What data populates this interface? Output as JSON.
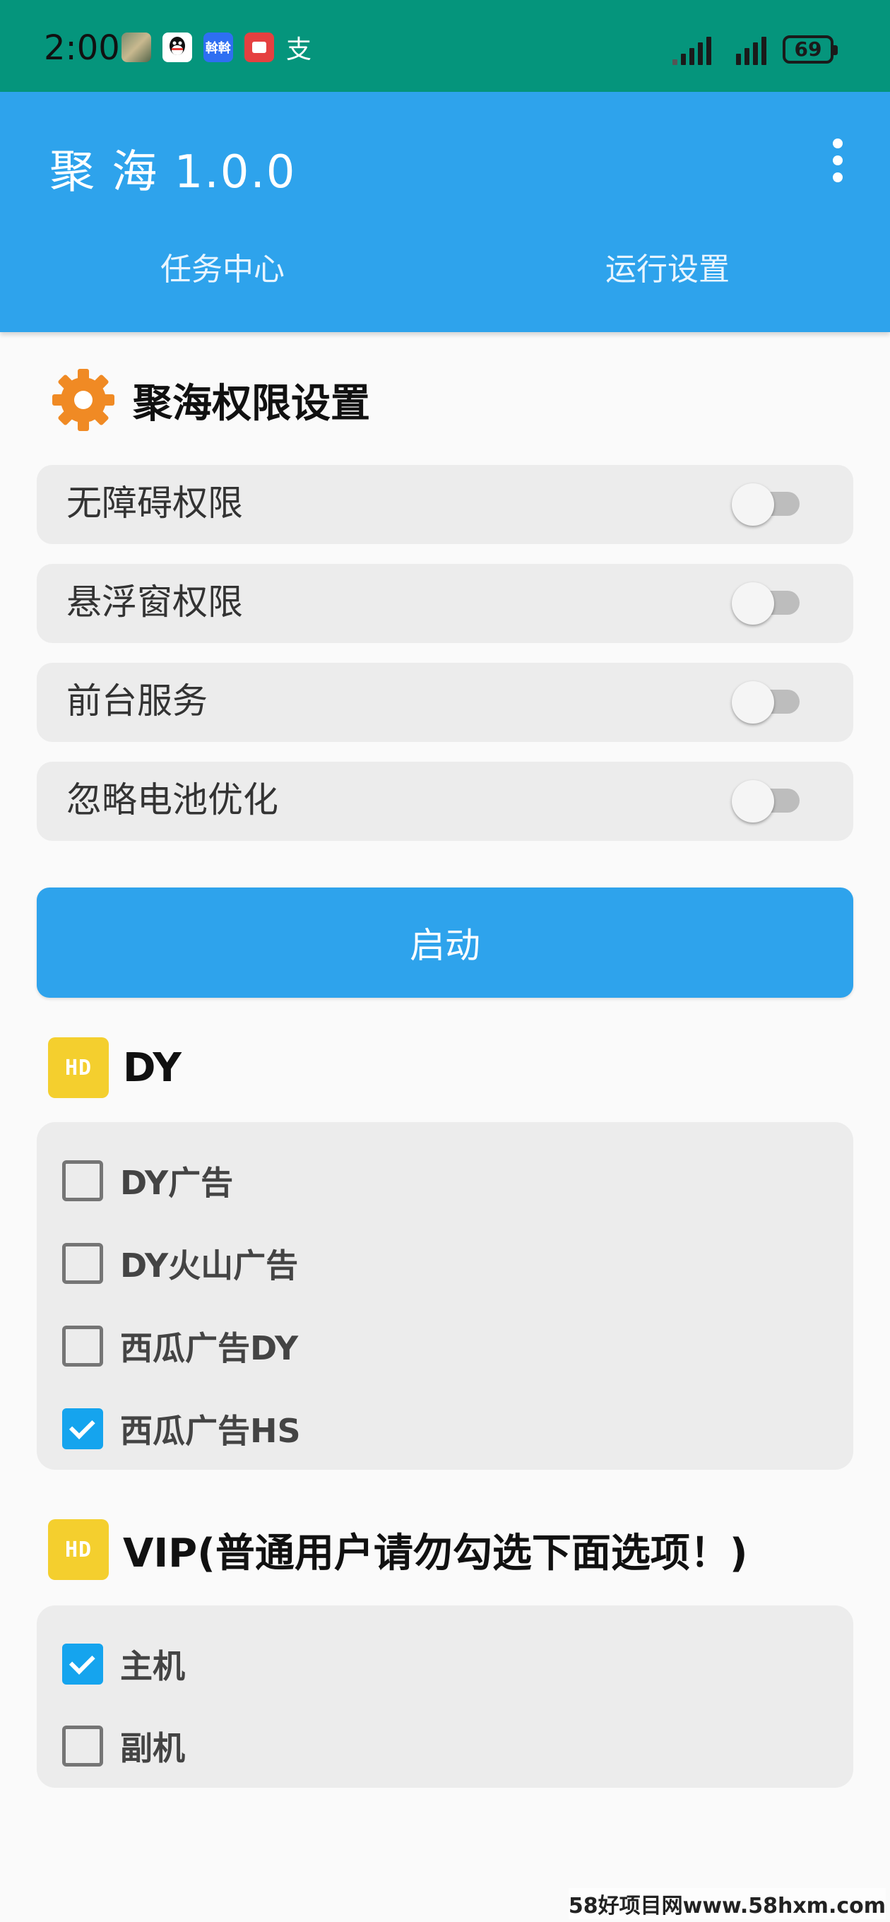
{
  "status_bar": {
    "time": "2:00",
    "battery": "69",
    "app_icons": [
      "photo-icon",
      "qq-icon",
      "app-icon",
      "video-icon",
      "alipay-icon"
    ],
    "alipay_glyph": "支",
    "blue_app_glyph": "斡斡"
  },
  "app_bar": {
    "title": "聚 海 1.0.0",
    "tabs": [
      {
        "label": "任务中心"
      },
      {
        "label": "运行设置"
      }
    ],
    "color": "#2ea3ec"
  },
  "permissions": {
    "title": "聚海权限设置",
    "items": [
      {
        "label": "无障碍权限",
        "enabled": false
      },
      {
        "label": "悬浮窗权限",
        "enabled": false
      },
      {
        "label": "前台服务",
        "enabled": false
      },
      {
        "label": "忽略电池优化",
        "enabled": false
      }
    ]
  },
  "start_button": {
    "label": "启动"
  },
  "dy_section": {
    "badge": "HD",
    "title": "DY",
    "options": [
      {
        "label": "DY广告",
        "checked": false
      },
      {
        "label": "DY火山广告",
        "checked": false
      },
      {
        "label": "西瓜广告DY",
        "checked": false
      },
      {
        "label": "西瓜广告HS",
        "checked": true
      }
    ]
  },
  "vip_section": {
    "badge": "HD",
    "title": "VIP(普通用户请勿勾选下面选项！)",
    "options": [
      {
        "label": "主机",
        "checked": true
      },
      {
        "label": "副机",
        "checked": false
      }
    ]
  },
  "watermark": "58好项目网www.58hxm.com"
}
